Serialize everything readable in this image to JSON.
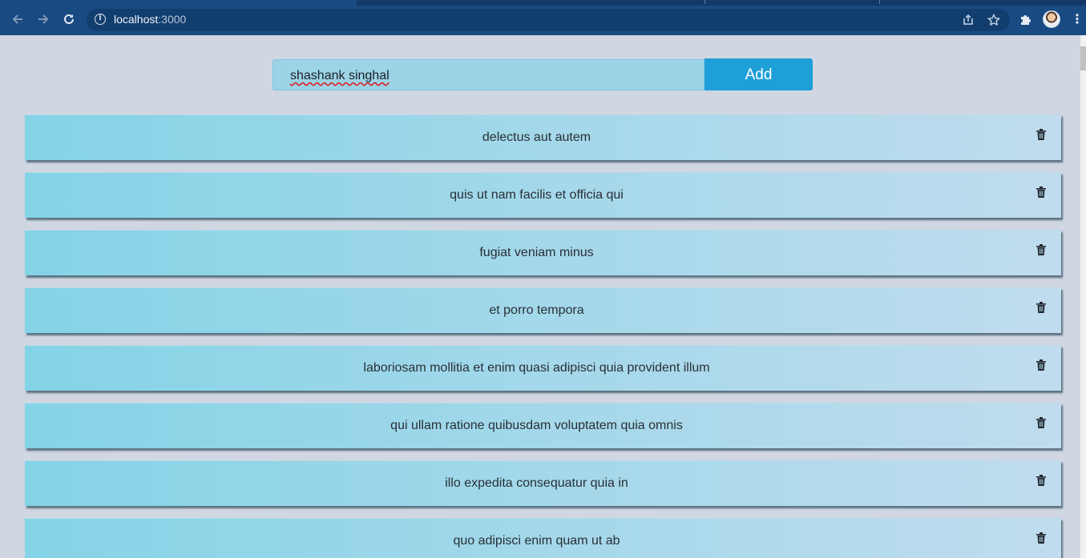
{
  "browser": {
    "url_host": "localhost",
    "url_port": ":3000",
    "icons": {
      "back": "arrow-left-icon",
      "forward": "arrow-right-icon",
      "reload": "reload-icon",
      "site_info": "info-icon",
      "share": "share-icon",
      "bookmark": "star-icon",
      "extensions": "puzzle-icon",
      "profile": "avatar",
      "menu": "kebab-menu-icon"
    }
  },
  "form": {
    "input_value": "shashank singhal",
    "add_label": "Add"
  },
  "todos": [
    {
      "text": "delectus aut autem"
    },
    {
      "text": "quis ut nam facilis et officia qui"
    },
    {
      "text": "fugiat veniam minus"
    },
    {
      "text": "et porro tempora"
    },
    {
      "text": "laboriosam mollitia et enim quasi adipisci quia provident illum"
    },
    {
      "text": "qui ullam ratione quibusdam voluptatem quia omnis"
    },
    {
      "text": "illo expedita consequatur quia in"
    },
    {
      "text": "quo adipisci enim quam ut ab"
    }
  ],
  "colors": {
    "page_background": "#d0d6e2",
    "add_button": "#1e9fd8",
    "input_background": "#9cd3e6",
    "item_gradient_start": "#84d3e6",
    "item_gradient_end": "#c0dcee"
  }
}
